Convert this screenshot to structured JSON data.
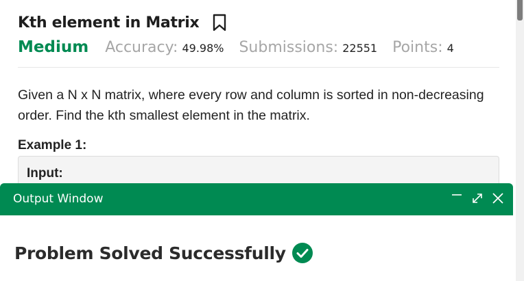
{
  "problem": {
    "title": "Kth element in Matrix",
    "difficulty": "Medium",
    "accuracy_label": "Accuracy:",
    "accuracy_value": "49.98%",
    "submissions_label": "Submissions:",
    "submissions_value": "22551",
    "points_label": "Points:",
    "points_value": "4",
    "description": "Given a N x N matrix, where every row and column is sorted in non-decreasing order. Find the kth smallest element in the matrix.",
    "example_title": "Example 1:",
    "example_input_label": "Input:"
  },
  "output_window": {
    "title": "Output Window",
    "status": "Problem Solved Successfully"
  },
  "icons": {
    "bookmark": "bookmark-icon",
    "minimize": "minimize-icon",
    "expand": "expand-icon",
    "close": "close-icon",
    "success": "check-circle-icon"
  },
  "colors": {
    "accent_green": "#008a52",
    "muted_gray": "#a6a6a6"
  }
}
